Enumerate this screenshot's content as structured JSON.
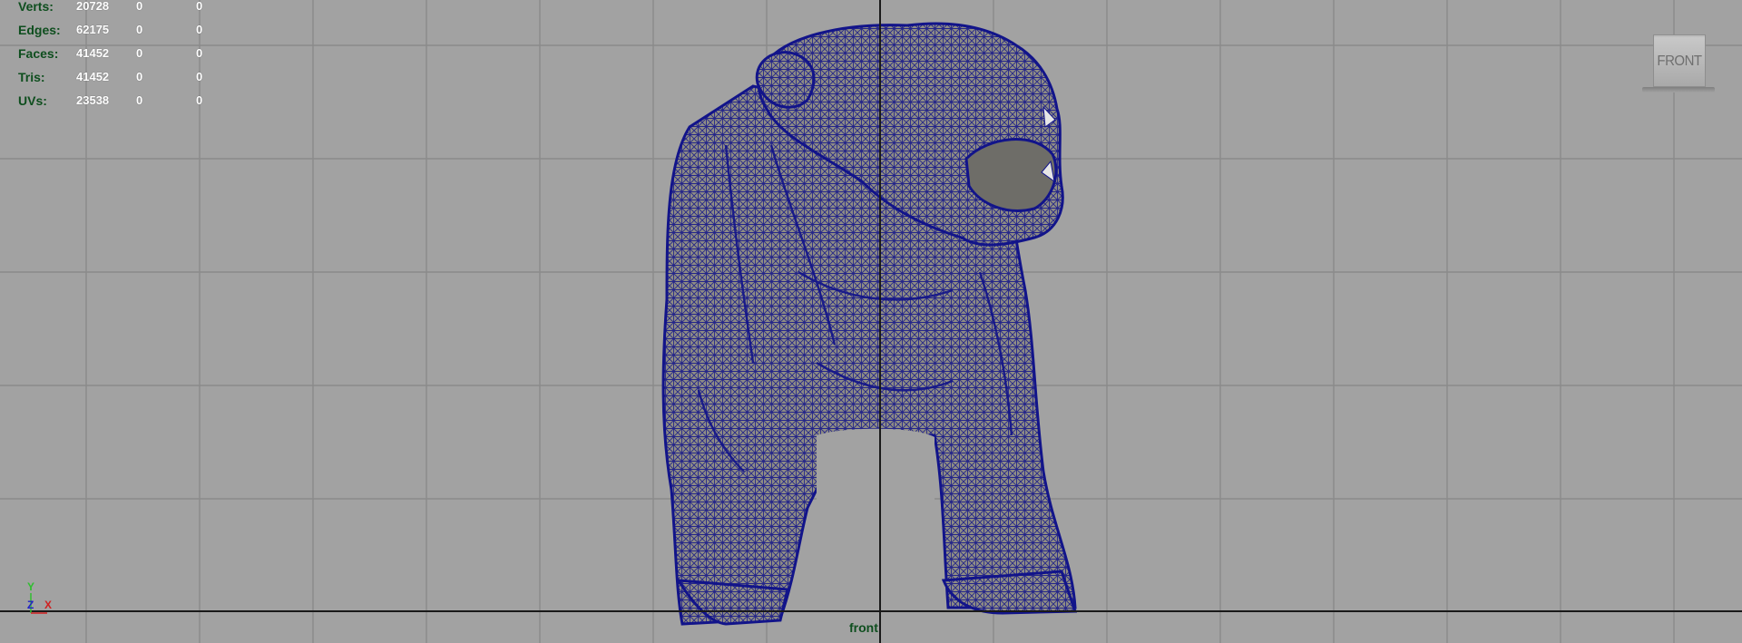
{
  "viewport": {
    "camera_name": "front",
    "view_cube_label": "FRONT",
    "background_color": "#a2a2a2",
    "grid_line_color": "#8a8a8a",
    "axis_line_color": "#1a1a1a",
    "mesh_wire_color": "#12148a",
    "mesh_fill_color": "#8e8c84"
  },
  "heads_up": {
    "rows": [
      {
        "label": "Verts:",
        "total": "20728",
        "selected": "0",
        "component": "0"
      },
      {
        "label": "Edges:",
        "total": "62175",
        "selected": "0",
        "component": "0"
      },
      {
        "label": "Faces:",
        "total": "41452",
        "selected": "0",
        "component": "0"
      },
      {
        "label": "Tris:",
        "total": "41452",
        "selected": "0",
        "component": "0"
      },
      {
        "label": "UVs:",
        "total": "23538",
        "selected": "0",
        "component": "0"
      }
    ]
  },
  "axis_gizmo": {
    "y": "Y",
    "z": "Z",
    "x": "X",
    "y_color": "#2fbe2f",
    "z_color": "#2020c8",
    "x_color": "#d02020"
  }
}
